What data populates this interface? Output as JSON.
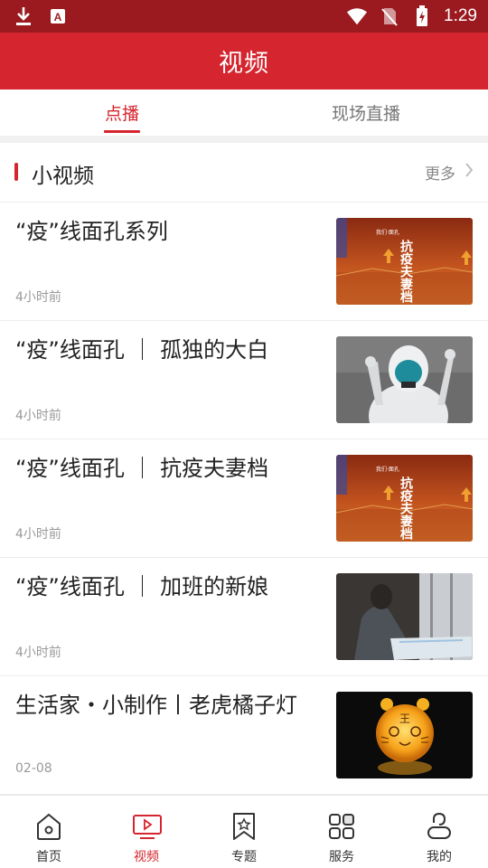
{
  "status_bar": {
    "time": "1:29"
  },
  "header": {
    "title": "视频"
  },
  "tabs": [
    {
      "label": "点播",
      "active": true
    },
    {
      "label": "现场直播",
      "active": false
    }
  ],
  "section": {
    "title": "小视频",
    "more_label": "更多"
  },
  "items": [
    {
      "title": "“疫”线面孔系列",
      "time": "4小时前",
      "thumb_text": "抗疫夫妻档"
    },
    {
      "title": "“疫”线面孔 ｜ 孤独的大白",
      "time": "4小时前"
    },
    {
      "title": "“疫”线面孔 ｜ 抗疫夫妻档",
      "time": "4小时前",
      "thumb_text": "抗疫夫妻档"
    },
    {
      "title": "“疫”线面孔 ｜ 加班的新娘",
      "time": "4小时前"
    },
    {
      "title": "生活家・小制作丨老虎橘子灯",
      "time": "02-08",
      "thumb_text": "王"
    }
  ],
  "bottom_nav": [
    {
      "label": "首页",
      "icon": "home-icon"
    },
    {
      "label": "视频",
      "icon": "video-icon",
      "active": true
    },
    {
      "label": "专题",
      "icon": "topic-bookmark-icon"
    },
    {
      "label": "服务",
      "icon": "services-grid-icon"
    },
    {
      "label": "我的",
      "icon": "profile-icon"
    }
  ],
  "colors": {
    "brand_red": "#d5252e",
    "status_bar": "#9a1a1f"
  }
}
